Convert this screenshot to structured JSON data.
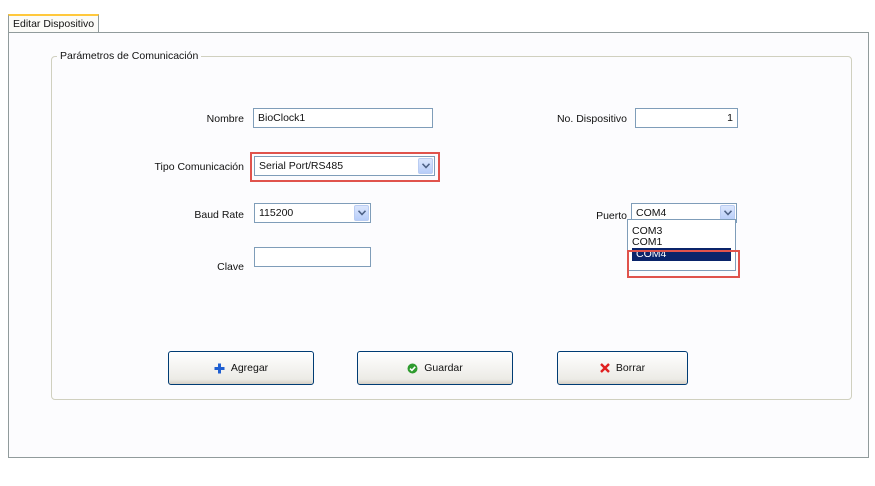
{
  "tab": {
    "label": "Editar Dispositivo"
  },
  "group": {
    "title": "Parámetros de Comunicación"
  },
  "form": {
    "nombre": {
      "label": "Nombre",
      "value": "BioClock1"
    },
    "no_dispositivo": {
      "label": "No. Dispositivo",
      "value": "1"
    },
    "tipo_comunicacion": {
      "label": "Tipo Comunicación",
      "value": "Serial Port/RS485"
    },
    "baud_rate": {
      "label": "Baud Rate",
      "value": "115200"
    },
    "puerto": {
      "label": "Puerto",
      "value": "COM4",
      "options": [
        "COM3",
        "COM1",
        "COM4"
      ],
      "selected_option": "COM4"
    },
    "clave": {
      "label": "Clave",
      "value": ""
    }
  },
  "buttons": {
    "agregar": "Agregar",
    "guardar": "Guardar",
    "borrar": "Borrar"
  },
  "colors": {
    "highlight": "#e0534c",
    "selection": "#0a246a",
    "tab_accent": "#ffc83c",
    "add_icon": "#1f5fd1",
    "save_icon": "#2e9b2e",
    "delete_icon": "#e02020"
  },
  "icons": {
    "agregar": "plus-icon",
    "guardar": "check-circle-icon",
    "borrar": "x-icon",
    "dropdown": "chevron-down-icon"
  }
}
